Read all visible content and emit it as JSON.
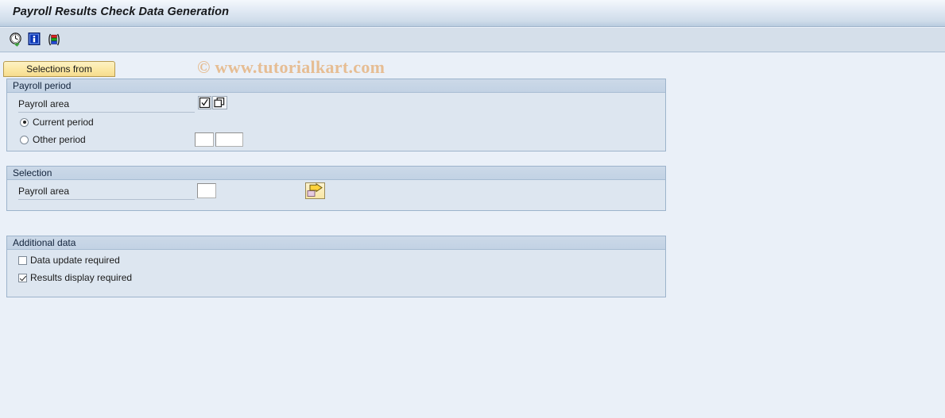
{
  "window": {
    "title": "Payroll Results Check Data Generation"
  },
  "toolbar": {
    "buttons": [
      {
        "name": "execute-check-button",
        "icon": "clock-check-icon",
        "tooltip": "Execute"
      },
      {
        "name": "information-button",
        "icon": "info-icon",
        "tooltip": "Information"
      },
      {
        "name": "variant-button",
        "icon": "color-bars-variant-icon",
        "tooltip": "Layout / Variant"
      }
    ]
  },
  "watermark": {
    "text": "© www.tutorialkart.com"
  },
  "tabs": [
    {
      "label": "Selections from",
      "selected": true
    }
  ],
  "groups": {
    "payroll_period": {
      "header": "Payroll period",
      "payroll_area_label": "Payroll area",
      "payroll_area_value": "",
      "checkbox_button_icon": "checkbox-checked-icon",
      "copy_button_icon": "multiple-windows-icon",
      "options": [
        {
          "label": "Current period",
          "selected": true
        },
        {
          "label": "Other period",
          "selected": false
        }
      ],
      "other_period_value_1": "",
      "other_period_value_2": ""
    },
    "selection": {
      "header": "Selection",
      "payroll_area_label": "Payroll area",
      "payroll_area_value": "",
      "multiple_selection_icon": "yellow-arrow-multiple-selection-icon"
    },
    "additional_data": {
      "header": "Additional data",
      "checkboxes": [
        {
          "label": "Data update required",
          "checked": false
        },
        {
          "label": "Results display required",
          "checked": true
        }
      ]
    }
  },
  "colors": {
    "title_bar_top": "#f4f8fc",
    "title_bar_bottom": "#b9ccdf",
    "toolbar_bg": "#d5dfea",
    "page_bg": "#eaf0f8",
    "group_bg": "#dde6f0",
    "group_header_bg": "#c6d4e6",
    "tab_yellow": "#fbe7a2",
    "watermark": "#e6bd93"
  }
}
